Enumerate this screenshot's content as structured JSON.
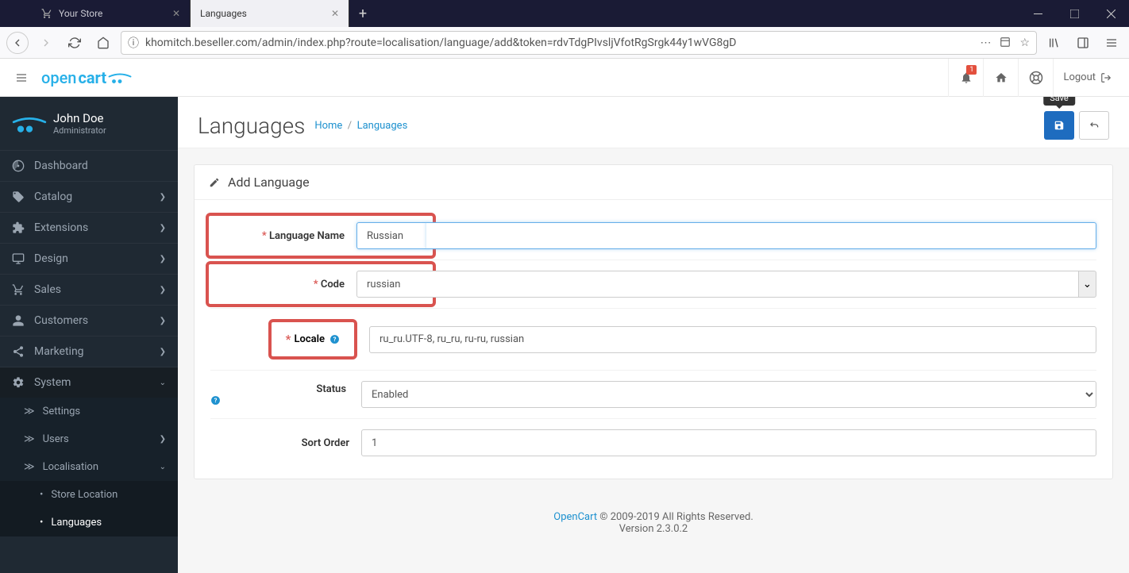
{
  "browser": {
    "tabs": [
      {
        "title": "Your Store",
        "active": false
      },
      {
        "title": "Languages",
        "active": true
      }
    ],
    "url": "khomitch.beseller.com/admin/index.php?route=localisation/language/add&token=rdvTdgPIvsljVfotRgSrgk44y1wVG8gD"
  },
  "header": {
    "logo_a": "open",
    "logo_b": "cart",
    "notification_count": "1",
    "logout": "Logout"
  },
  "profile": {
    "name": "John Doe",
    "role": "Administrator"
  },
  "sidebar": {
    "items": [
      {
        "icon": "dashboard",
        "label": "Dashboard"
      },
      {
        "icon": "tag",
        "label": "Catalog",
        "expandable": true
      },
      {
        "icon": "puzzle",
        "label": "Extensions",
        "expandable": true
      },
      {
        "icon": "desktop",
        "label": "Design",
        "expandable": true
      },
      {
        "icon": "cart",
        "label": "Sales",
        "expandable": true
      },
      {
        "icon": "user",
        "label": "Customers",
        "expandable": true
      },
      {
        "icon": "share",
        "label": "Marketing",
        "expandable": true
      },
      {
        "icon": "gear",
        "label": "System",
        "expandable": true,
        "expanded": true
      }
    ],
    "system_sub": [
      {
        "label": "Settings"
      },
      {
        "label": "Users",
        "expandable": true
      },
      {
        "label": "Localisation",
        "expandable": true,
        "expanded": true
      }
    ],
    "localisation_sub": [
      {
        "label": "Store Location"
      },
      {
        "label": "Languages",
        "active": true
      }
    ]
  },
  "page": {
    "title": "Languages",
    "breadcrumb_home": "Home",
    "breadcrumb_current": "Languages",
    "save_tooltip": "Save"
  },
  "panel": {
    "title": "Add Language"
  },
  "form": {
    "language_name": {
      "label": "Language Name",
      "value": "Russian",
      "placeholder": "Language Name"
    },
    "code": {
      "label": "Code",
      "value": "russian",
      "placeholder": "Code"
    },
    "locale": {
      "label": "Locale",
      "value": "ru_ru.UTF-8, ru_ru, ru-ru, russian",
      "placeholder": "Locale"
    },
    "status": {
      "label": "Status",
      "value": "Enabled"
    },
    "sort_order": {
      "label": "Sort Order",
      "value": "1",
      "placeholder": "Sort Order"
    }
  },
  "footer": {
    "link": "OpenCart",
    "text": " © 2009-2019 All Rights Reserved.",
    "version": "Version 2.3.0.2"
  }
}
